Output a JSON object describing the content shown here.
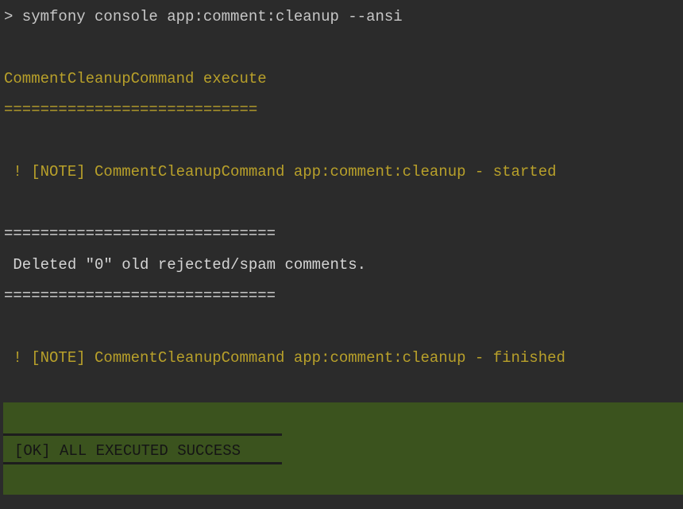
{
  "terminal": {
    "command": "> symfony console app:comment:cleanup --ansi",
    "title": "CommentCleanupCommand execute",
    "title_rule": "============================",
    "note_started": " ! [NOTE] CommentCleanupCommand app:comment:cleanup - started",
    "rule_top": "==============================",
    "deleted_message": " Deleted \"0\" old rejected/spam comments.",
    "rule_bottom": "==============================",
    "note_finished": " ! [NOTE] CommentCleanupCommand app:comment:cleanup - finished",
    "ok_message": "[OK] ALL EXECUTED SUCCESS"
  },
  "colors": {
    "background": "#2b2b2b",
    "text": "#d4d4d4",
    "note": "#b8a02a",
    "ok_background": "#3b531e",
    "ok_text": "#151515"
  }
}
